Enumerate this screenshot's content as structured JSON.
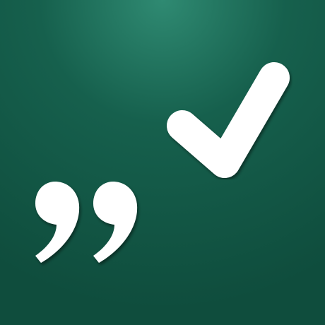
{
  "app_icon": {
    "glyphs": [
      "quote-marks-icon",
      "checkmark-icon"
    ],
    "colors": {
      "background_dark": "#0f4d3d",
      "background_mid": "#16604d",
      "background_highlight": "#2f8a72",
      "glyph": "#ffffff"
    }
  }
}
